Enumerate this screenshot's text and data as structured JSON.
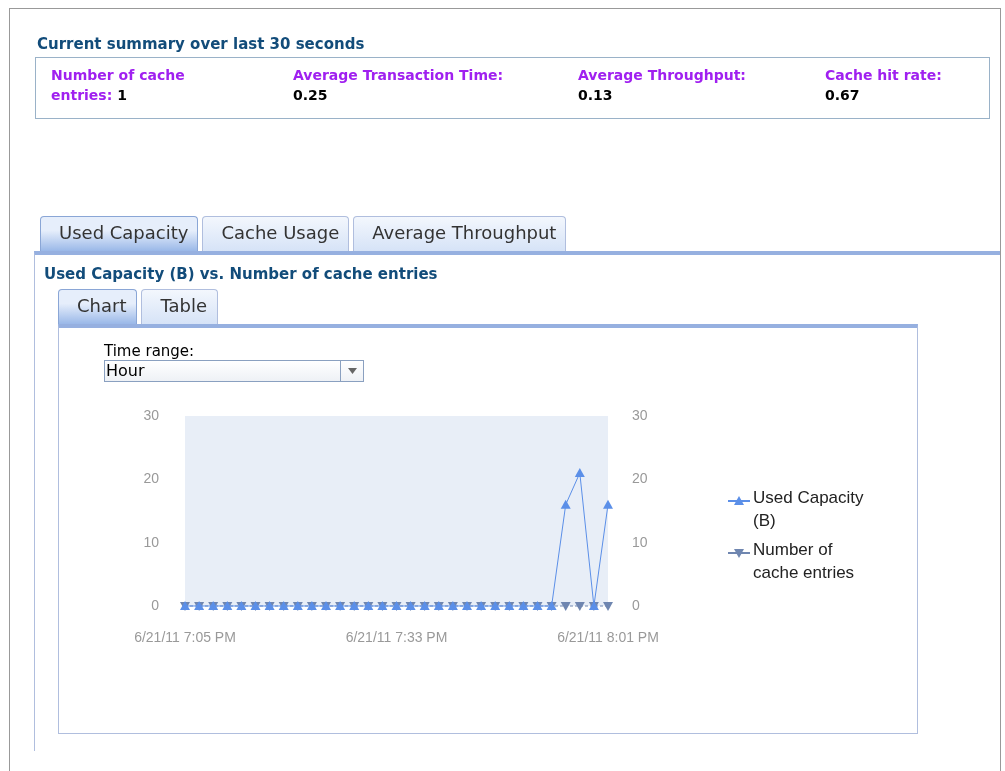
{
  "summary": {
    "title": "Current summary over last 30 seconds",
    "metrics": [
      {
        "label": "Number of cache entries:",
        "value": "1"
      },
      {
        "label": "Average Transaction Time:",
        "value": "0.25"
      },
      {
        "label": "Average Throughput:",
        "value": "0.13"
      },
      {
        "label": "Cache hit rate:",
        "value": "0.67"
      }
    ]
  },
  "tabs": [
    {
      "label": "Used Capacity",
      "selected": true
    },
    {
      "label": "Cache Usage",
      "selected": false
    },
    {
      "label": "Average Throughput",
      "selected": false
    }
  ],
  "panel_title": "Used Capacity (B) vs. Number of cache entries",
  "view_tabs": [
    {
      "label": "Chart",
      "selected": true
    },
    {
      "label": "Table",
      "selected": false
    }
  ],
  "time_range": {
    "label": "Time range:",
    "value": "Hour"
  },
  "chart_data": {
    "type": "line",
    "categories": [
      "6/21/11 7:05 PM",
      null,
      null,
      null,
      null,
      null,
      null,
      null,
      null,
      null,
      null,
      null,
      null,
      null,
      null,
      "6/21/11 7:33 PM",
      null,
      null,
      null,
      null,
      null,
      null,
      null,
      null,
      null,
      null,
      null,
      null,
      null,
      null,
      "6/21/11 8:01 PM"
    ],
    "ylim": [
      0,
      30
    ],
    "yticks": [
      0,
      10,
      20,
      30
    ],
    "y2lim": [
      0,
      30
    ],
    "y2ticks": [
      0,
      10,
      20,
      30
    ],
    "legend": "right",
    "series": [
      {
        "name": "Used Capacity (B)",
        "color": "#5b8fe8",
        "marker": "triangle",
        "line_style": "solid",
        "values": [
          0,
          0,
          0,
          0,
          0,
          0,
          0,
          0,
          0,
          0,
          0,
          0,
          0,
          0,
          0,
          0,
          0,
          0,
          0,
          0,
          0,
          0,
          0,
          0,
          0,
          0,
          0,
          16,
          21,
          0,
          16
        ]
      },
      {
        "name": "Number of cache entries",
        "color": "#6f86b0",
        "marker": "triangle",
        "line_style": "dashed",
        "values": [
          0,
          0,
          0,
          0,
          0,
          0,
          0,
          0,
          0,
          0,
          0,
          0,
          0,
          0,
          0,
          0,
          0,
          0,
          0,
          0,
          0,
          0,
          0,
          0,
          0,
          0,
          0,
          0,
          0,
          0,
          0
        ]
      }
    ]
  }
}
